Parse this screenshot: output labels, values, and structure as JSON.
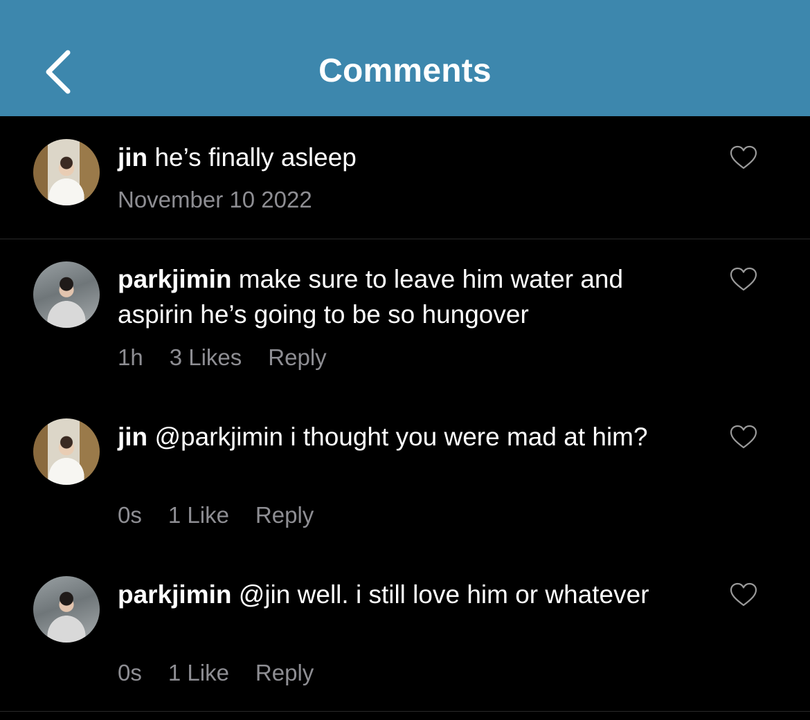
{
  "header": {
    "title": "Comments",
    "background_color": "#3d87ad",
    "back_icon": "chevron-left-icon"
  },
  "comments": [
    {
      "username": "jin",
      "text": "he’s finally asleep",
      "date": "November 10 2022",
      "avatar": "jin-avatar"
    },
    {
      "username": "parkjimin",
      "text": "make sure to leave him water and aspirin he’s going to be so hungover",
      "time": "1h",
      "likes": "3 Likes",
      "reply": "Reply",
      "avatar": "parkjimin-avatar"
    },
    {
      "username": "jin",
      "mention": "@parkjimin",
      "text": "i thought you were mad at him?",
      "time": "0s",
      "likes": "1 Like",
      "reply": "Reply",
      "avatar": "jin-avatar"
    },
    {
      "username": "parkjimin",
      "mention": "@jin",
      "text": "well. i still love him or whatever",
      "time": "0s",
      "likes": "1 Like",
      "reply": "Reply",
      "avatar": "parkjimin-avatar"
    }
  ],
  "colors": {
    "background": "#000000",
    "text": "#ffffff",
    "secondary_text": "#8e8e93"
  }
}
